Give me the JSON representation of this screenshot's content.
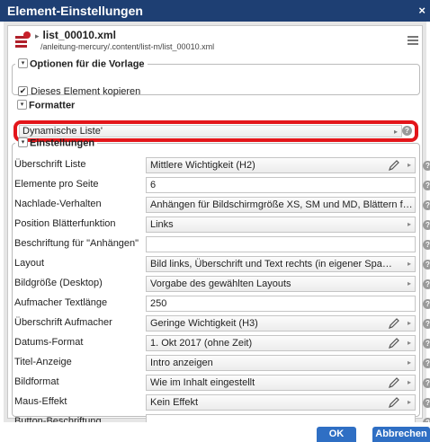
{
  "dialog": {
    "title": "Element-Einstellungen",
    "close_label": "×"
  },
  "resource": {
    "name": "list_00010.xml",
    "path": "/anleitung-mercury/.content/list-m/list_00010.xml"
  },
  "options": {
    "legend": "Optionen für die Vorlage",
    "copy_label": "Dieses Element kopieren",
    "copy_checked": "✔"
  },
  "formatter": {
    "legend": "Formatter",
    "value": "Dynamische Liste'"
  },
  "settings": {
    "legend": "Einstellungen",
    "rows": [
      {
        "label": "Überschrift Liste",
        "value": "Mittlere Wichtigkeit (H2)"
      },
      {
        "label": "Elemente pro Seite",
        "value": "6"
      },
      {
        "label": "Nachlade-Verhalten",
        "value": "Anhängen für Bildschirmgröße XS, SM und MD, Blättern für LG und..."
      },
      {
        "label": "Position Blätterfunktion",
        "value": "Links"
      },
      {
        "label": "Beschriftung für \"Anhängen\"",
        "value": ""
      },
      {
        "label": "Layout",
        "value": "Bild links, Überschrift und Text rechts (in eigener Spalte)"
      },
      {
        "label": "Bildgröße (Desktop)",
        "value": "Vorgabe des gewählten Layouts"
      },
      {
        "label": "Aufmacher Textlänge",
        "value": "250"
      },
      {
        "label": "Überschrift Aufmacher",
        "value": "Geringe Wichtigkeit (H3)"
      },
      {
        "label": "Datums-Format",
        "value": "1. Okt 2017 (ohne Zeit)"
      },
      {
        "label": "Titel-Anzeige",
        "value": "Intro anzeigen"
      },
      {
        "label": "Bildformat",
        "value": "Wie im Inhalt eingestellt"
      },
      {
        "label": "Maus-Effekt",
        "value": "Kein Effekt"
      },
      {
        "label": "Button-Beschriftung",
        "value": ""
      }
    ]
  },
  "glyphs": {
    "caret": "▸",
    "help": "?",
    "toggle": "▾",
    "res_arrow": "▸"
  },
  "buttons": {
    "ok": "OK",
    "cancel": "Abbrechen"
  },
  "colors": {
    "titlebar": "#1e3f73",
    "button": "#2f6fc4",
    "highlight": "#e3151a"
  }
}
